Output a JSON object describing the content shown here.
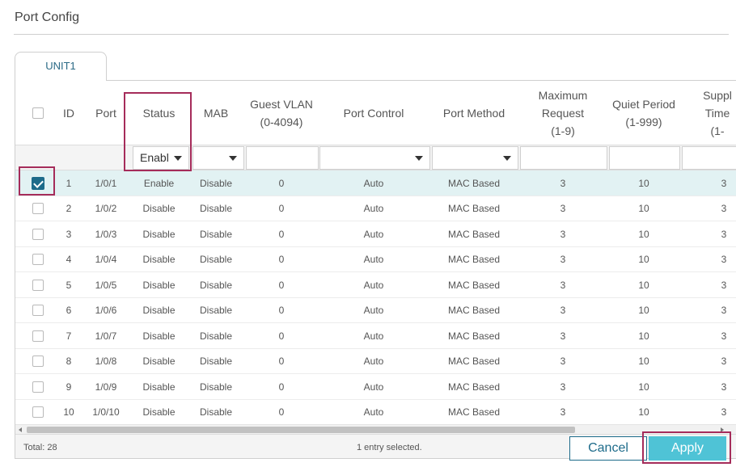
{
  "page": {
    "title": "Port Config"
  },
  "tabs": [
    {
      "label": "UNIT1"
    }
  ],
  "table": {
    "headers": {
      "id": "ID",
      "port": "Port",
      "status": "Status",
      "mab": "MAB",
      "guest_vlan": "Guest VLAN\n(0-4094)",
      "port_control": "Port Control",
      "port_method": "Port Method",
      "max_request": "Maximum\nRequest\n(1-9)",
      "quiet_period": "Quiet Period\n(1-999)",
      "supplicant_timeout": "Suppl\nTime\n(1-"
    },
    "filters": {
      "status": "Enabl",
      "mab": "",
      "guest_vlan": "",
      "port_control": "",
      "port_method": "",
      "max_request": "",
      "quiet_period": ""
    },
    "rows": [
      {
        "checked": true,
        "id": "1",
        "port": "1/0/1",
        "status": "Enable",
        "mab": "Disable",
        "guest_vlan": "0",
        "port_control": "Auto",
        "port_method": "MAC Based",
        "max_request": "3",
        "quiet_period": "10",
        "supplicant": "3"
      },
      {
        "checked": false,
        "id": "2",
        "port": "1/0/2",
        "status": "Disable",
        "mab": "Disable",
        "guest_vlan": "0",
        "port_control": "Auto",
        "port_method": "MAC Based",
        "max_request": "3",
        "quiet_period": "10",
        "supplicant": "3"
      },
      {
        "checked": false,
        "id": "3",
        "port": "1/0/3",
        "status": "Disable",
        "mab": "Disable",
        "guest_vlan": "0",
        "port_control": "Auto",
        "port_method": "MAC Based",
        "max_request": "3",
        "quiet_period": "10",
        "supplicant": "3"
      },
      {
        "checked": false,
        "id": "4",
        "port": "1/0/4",
        "status": "Disable",
        "mab": "Disable",
        "guest_vlan": "0",
        "port_control": "Auto",
        "port_method": "MAC Based",
        "max_request": "3",
        "quiet_period": "10",
        "supplicant": "3"
      },
      {
        "checked": false,
        "id": "5",
        "port": "1/0/5",
        "status": "Disable",
        "mab": "Disable",
        "guest_vlan": "0",
        "port_control": "Auto",
        "port_method": "MAC Based",
        "max_request": "3",
        "quiet_period": "10",
        "supplicant": "3"
      },
      {
        "checked": false,
        "id": "6",
        "port": "1/0/6",
        "status": "Disable",
        "mab": "Disable",
        "guest_vlan": "0",
        "port_control": "Auto",
        "port_method": "MAC Based",
        "max_request": "3",
        "quiet_period": "10",
        "supplicant": "3"
      },
      {
        "checked": false,
        "id": "7",
        "port": "1/0/7",
        "status": "Disable",
        "mab": "Disable",
        "guest_vlan": "0",
        "port_control": "Auto",
        "port_method": "MAC Based",
        "max_request": "3",
        "quiet_period": "10",
        "supplicant": "3"
      },
      {
        "checked": false,
        "id": "8",
        "port": "1/0/8",
        "status": "Disable",
        "mab": "Disable",
        "guest_vlan": "0",
        "port_control": "Auto",
        "port_method": "MAC Based",
        "max_request": "3",
        "quiet_period": "10",
        "supplicant": "3"
      },
      {
        "checked": false,
        "id": "9",
        "port": "1/0/9",
        "status": "Disable",
        "mab": "Disable",
        "guest_vlan": "0",
        "port_control": "Auto",
        "port_method": "MAC Based",
        "max_request": "3",
        "quiet_period": "10",
        "supplicant": "3"
      },
      {
        "checked": false,
        "id": "10",
        "port": "1/0/10",
        "status": "Disable",
        "mab": "Disable",
        "guest_vlan": "0",
        "port_control": "Auto",
        "port_method": "MAC Based",
        "max_request": "3",
        "quiet_period": "10",
        "supplicant": "3"
      }
    ]
  },
  "footer": {
    "total": "Total: 28",
    "selection_info": "1 entry selected."
  },
  "buttons": {
    "cancel": "Cancel",
    "apply": "Apply"
  },
  "colors": {
    "accent": "#1d6b8a",
    "apply": "#4fc3d6",
    "selected_row": "#e2f2f3",
    "highlight": "#a52c5a"
  },
  "icons": {
    "checkbox_checked": "check-icon",
    "dropdown": "chevron-down-icon"
  }
}
